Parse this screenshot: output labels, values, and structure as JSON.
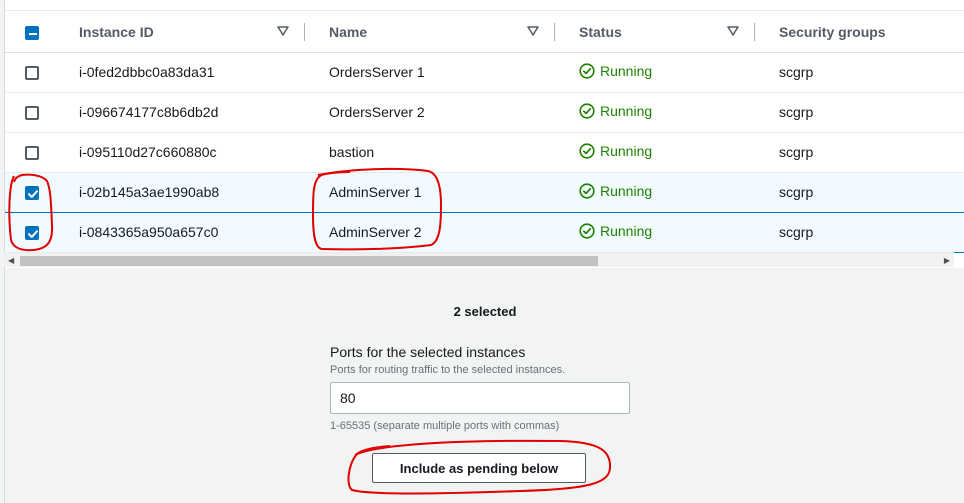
{
  "table": {
    "columns": [
      {
        "label": "Instance ID"
      },
      {
        "label": "Name"
      },
      {
        "label": "Status"
      },
      {
        "label": "Security groups"
      }
    ],
    "rows": [
      {
        "id": "i-0fed2dbbc0a83da31",
        "name": "OrdersServer 1",
        "status": "Running",
        "sg": "scgrp",
        "checked": false
      },
      {
        "id": "i-096674177c8b6db2d",
        "name": "OrdersServer 2",
        "status": "Running",
        "sg": "scgrp",
        "checked": false
      },
      {
        "id": "i-095110d27c660880c",
        "name": "bastion",
        "status": "Running",
        "sg": "scgrp",
        "checked": false
      },
      {
        "id": "i-02b145a3ae1990ab8",
        "name": "AdminServer 1",
        "status": "Running",
        "sg": "scgrp",
        "checked": true
      },
      {
        "id": "i-0843365a950a657c0",
        "name": "AdminServer 2",
        "status": "Running",
        "sg": "scgrp",
        "checked": true
      }
    ]
  },
  "panel": {
    "selected_count": "2 selected",
    "ports_label": "Ports for the selected instances",
    "ports_description": "Ports for routing traffic to the selected instances.",
    "ports_value": "80",
    "ports_hint": "1-65535 (separate multiple ports with commas)",
    "include_button": "Include as pending below"
  },
  "colors": {
    "accent": "#0073bb",
    "running": "#1d8102",
    "annotation": "#e00000"
  },
  "icons": {
    "status": "check-circle-icon",
    "sort": "caret-down-outline-icon"
  }
}
